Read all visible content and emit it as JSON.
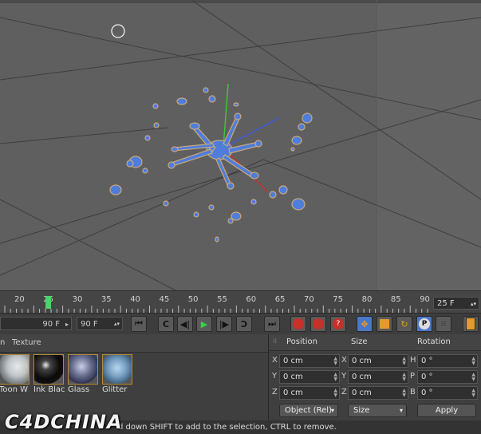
{
  "timeline": {
    "ticks": [
      "20",
      "25",
      "30",
      "35",
      "40",
      "45",
      "50",
      "55",
      "60",
      "65",
      "70",
      "75",
      "80",
      "85",
      "90"
    ],
    "fps": "25 F"
  },
  "playbar": {
    "current_frame": "90 F",
    "end_frame": "90 F"
  },
  "materials": {
    "tabs": [
      "n",
      "Texture"
    ],
    "items": [
      {
        "label": "Toon W"
      },
      {
        "label": "Ink Blac"
      },
      {
        "label": "Glass"
      },
      {
        "label": "Glitter"
      }
    ]
  },
  "coordinates": {
    "headers": {
      "position": "Position",
      "size": "Size",
      "rotation": "Rotation"
    },
    "rows": [
      {
        "axis_pos": "X",
        "pos": "0 cm",
        "axis_size": "X",
        "size": "0 cm",
        "axis_rot": "H",
        "rot": "0 °"
      },
      {
        "axis_pos": "Y",
        "pos": "0 cm",
        "axis_size": "Y",
        "size": "0 cm",
        "axis_rot": "P",
        "rot": "0 °"
      },
      {
        "axis_pos": "Z",
        "pos": "0 cm",
        "axis_size": "Z",
        "size": "0 cm",
        "axis_rot": "B",
        "rot": "0 °"
      }
    ],
    "mode_select": "Object (Rel)",
    "size_select": "Size",
    "apply_label": "Apply"
  },
  "status": {
    "text": "d down SHIFT to add to the selection, CTRL to remove."
  },
  "watermark": "C4DCHINA",
  "colors": {
    "viewport_bg": "#5f5f5f",
    "splash_blue": "#4f7ddc",
    "timeline_marker": "#4cd36a",
    "play_green": "#39d04a",
    "record_red": "#c8302a",
    "tool_orange": "#e29b2c"
  }
}
